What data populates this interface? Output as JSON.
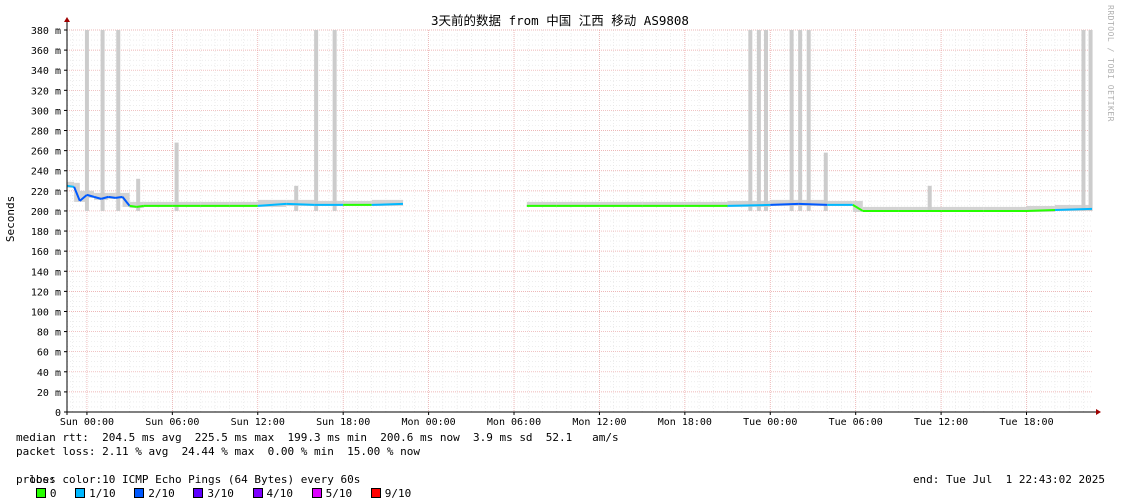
{
  "chart_data": {
    "type": "line",
    "title": "3天前的数据 from 中国 江西 移动 AS9808",
    "ylabel": "Seconds",
    "xlabel": "",
    "ylim": [
      0,
      380
    ],
    "y_ticks": [
      "0",
      "20 m",
      "40 m",
      "60 m",
      "80 m",
      "100 m",
      "120 m",
      "140 m",
      "160 m",
      "180 m",
      "200 m",
      "220 m",
      "240 m",
      "260 m",
      "280 m",
      "300 m",
      "320 m",
      "340 m",
      "360 m",
      "380 m"
    ],
    "x_ticks": [
      "Sun 00:00",
      "Sun 06:00",
      "Sun 12:00",
      "Sun 18:00",
      "Mon 00:00",
      "Mon 06:00",
      "Mon 12:00",
      "Mon 18:00",
      "Tue 00:00",
      "Tue 06:00",
      "Tue 12:00",
      "Tue 18:00"
    ],
    "x_unit": "hours since Sun 00:00",
    "xlim": [
      -1.4,
      70.6
    ],
    "grid": true,
    "segments": [
      {
        "x": [
          -1.4,
          -0.9,
          -0.5,
          0.0,
          0.5,
          1.0,
          1.5,
          2.0,
          2.5,
          3.0,
          3.5,
          4.0,
          6.0,
          8.0,
          10.0,
          12.0,
          14.0,
          16.0,
          18.0,
          20.0,
          22.2
        ],
        "y": [
          225,
          224,
          210,
          216,
          214,
          212,
          214,
          213,
          214,
          205,
          204,
          205,
          205,
          205,
          205,
          205,
          207,
          206,
          206,
          206,
          207
        ],
        "loss": [
          1,
          2,
          2,
          2,
          2,
          2,
          2,
          2,
          2,
          0,
          0,
          0,
          0,
          0,
          0,
          1,
          1,
          1,
          0,
          1,
          1
        ]
      },
      {
        "x": [
          30.9,
          33.0,
          36.0,
          39.0,
          42.0,
          45.0,
          48.0,
          50.0,
          52.0,
          53.8,
          54.5,
          57.0,
          60.0,
          63.0,
          66.0,
          68.0,
          70.6
        ],
        "y": [
          205,
          205,
          205,
          205,
          205,
          205,
          206,
          207,
          206,
          206,
          200,
          200,
          200,
          200,
          200,
          201,
          202
        ],
        "loss": [
          0,
          0,
          0,
          0,
          0,
          1,
          2,
          2,
          1,
          0,
          0,
          0,
          0,
          0,
          0,
          1,
          2
        ]
      }
    ],
    "smoke_spikes": [
      {
        "x": 0.0,
        "y": 380
      },
      {
        "x": 1.1,
        "y": 380
      },
      {
        "x": 2.2,
        "y": 380
      },
      {
        "x": 3.6,
        "y": 232
      },
      {
        "x": 6.3,
        "y": 268
      },
      {
        "x": 14.7,
        "y": 225
      },
      {
        "x": 16.1,
        "y": 380
      },
      {
        "x": 17.4,
        "y": 380
      },
      {
        "x": 46.6,
        "y": 380
      },
      {
        "x": 47.2,
        "y": 380
      },
      {
        "x": 47.7,
        "y": 380
      },
      {
        "x": 49.5,
        "y": 380
      },
      {
        "x": 50.1,
        "y": 380
      },
      {
        "x": 50.7,
        "y": 380
      },
      {
        "x": 51.9,
        "y": 258
      },
      {
        "x": 59.2,
        "y": 225
      },
      {
        "x": 70.0,
        "y": 380
      },
      {
        "x": 70.5,
        "y": 380
      }
    ],
    "legend_loss_colors": [
      {
        "label": "0",
        "color": "#26ff00"
      },
      {
        "label": "1/10",
        "color": "#00b8ff"
      },
      {
        "label": "2/10",
        "color": "#0059ff"
      },
      {
        "label": "3/10",
        "color": "#5e00ff"
      },
      {
        "label": "4/10",
        "color": "#7e00ff"
      },
      {
        "label": "5/10",
        "color": "#dd00ff"
      },
      {
        "label": "9/10",
        "color": "#ff0000"
      }
    ]
  },
  "stats": {
    "median_rtt": "median rtt:  204.5 ms avg  225.5 ms max  199.3 ms min  200.6 ms now  3.9 ms sd  52.1   am/s",
    "packet_loss": "packet loss: 2.11 % avg  24.44 % max  0.00 % min  15.00 % now",
    "loss_color_label": "loss color:",
    "probe": "probe:       10 ICMP Echo Pings (64 Bytes) every 60s",
    "end": "end: Tue Jul  1 22:43:02 2025"
  },
  "watermark": "RRDTOOL / TOBI OETIKER"
}
